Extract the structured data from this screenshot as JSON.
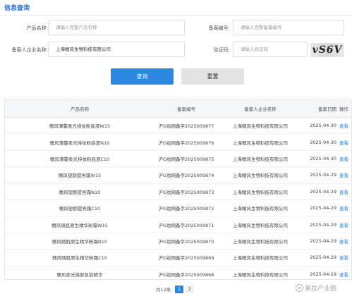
{
  "header": {
    "title": "信息查询"
  },
  "form": {
    "product_name_label": "产品名称:",
    "product_name_placeholder": "请输入完整产品名称",
    "record_no_label": "备案编号:",
    "record_no_placeholder": "请输入完整备案编号",
    "company_label": "备案人企业名称:",
    "company_value": "上海鳍风生物科技有限公司",
    "captcha_label": "验证码:",
    "captcha_placeholder": "请输入验证码",
    "captcha_text": "vS6V"
  },
  "buttons": {
    "query": "查询",
    "reset": "重置"
  },
  "table": {
    "headers": [
      "产品名称",
      "备案编号",
      "备案人企业名称",
      "备案日期",
      "操作"
    ],
    "rows": [
      {
        "name": "鳍风薄薹柔光持妆粉底液W15",
        "record": "沪G妆网备字2025009877",
        "company": "上海鳍风生物科技有限公司",
        "date": "2025-04-30",
        "action": "查看"
      },
      {
        "name": "鳍风薄薹柔光持妆粉底液N10",
        "record": "沪G妆网备字2025009876",
        "company": "上海鳍风生物科技有限公司",
        "date": "2025-04-30",
        "action": "查看"
      },
      {
        "name": "鳍风薄薹柔光持妆粉底液C10",
        "record": "沪G妆网备字2025009875",
        "company": "上海鳍风生物科技有限公司",
        "date": "2025-04-30",
        "action": "查看"
      },
      {
        "name": "鳍风塑颜提亮霜W15",
        "record": "沪G妆网备字2025009874",
        "company": "上海鳍风生物科技有限公司",
        "date": "2025-04-29",
        "action": "查看"
      },
      {
        "name": "鳍风塑颜提亮霜N10",
        "record": "沪G妆网备字2025009873",
        "company": "上海鳍风生物科技有限公司",
        "date": "2025-04-29",
        "action": "查看"
      },
      {
        "name": "鳍风塑颜提亮霜C10",
        "record": "沪G妆网备字2025009872",
        "company": "上海鳍风生物科技有限公司",
        "date": "2025-04-29",
        "action": "查看"
      },
      {
        "name": "鳍风随肌原生精华粉霜W15",
        "record": "沪G妆网备字2025009871",
        "company": "上海鳍风生物科技有限公司",
        "date": "2025-04-29",
        "action": "查看"
      },
      {
        "name": "鳍风随肌原生精华粉霜N10",
        "record": "沪G妆网备字2025009870",
        "company": "上海鳍风生物科技有限公司",
        "date": "2025-04-29",
        "action": "查看"
      },
      {
        "name": "鳍风随肌原生精华粉霜C10",
        "record": "沪G妆网备字2025009869",
        "company": "上海鳍风生物科技有限公司",
        "date": "2025-04-29",
        "action": "查看"
      },
      {
        "name": "鳍风柔光焕颜妆前精华",
        "record": "沪G妆网备字2025009868",
        "company": "上海鳍风生物科技有限公司",
        "date": "2025-04-29",
        "action": "查看"
      }
    ]
  },
  "pagination": {
    "total": "共12条",
    "page1": "1",
    "page2": "2"
  },
  "watermark": {
    "text": "美妆产业圈",
    "icon": "watermark-logo-icon"
  },
  "colors": {
    "accent": "#2d86e0",
    "title": "#2a6fd6"
  }
}
